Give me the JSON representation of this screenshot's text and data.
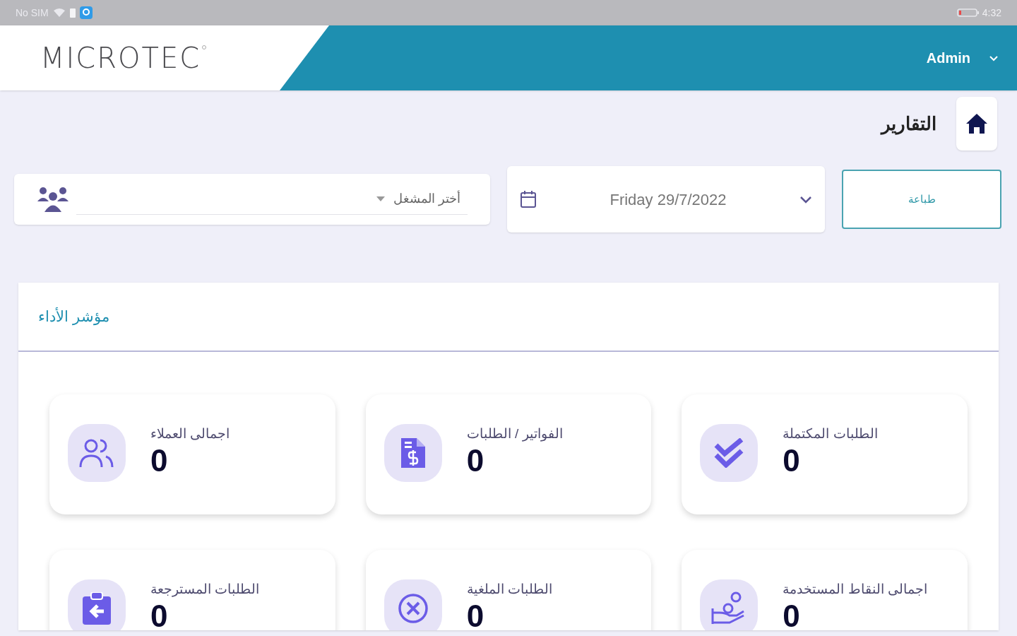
{
  "status_bar": {
    "carrier": "No SIM",
    "time": "4:32"
  },
  "header": {
    "logo": "MICROTEC",
    "user": "Admin"
  },
  "page_title": "التقارير",
  "filters": {
    "print_button": "طباعة",
    "date": "Friday 29/7/2022",
    "operator_select": {
      "placeholder": "أختر المشغل"
    }
  },
  "panel": {
    "title": "مؤشر الأداء",
    "cards": [
      {
        "kind": "check",
        "label": "الطلبات المكتملة",
        "value": "0"
      },
      {
        "kind": "invoice",
        "label": "الفواتير / الطلبات",
        "value": "0"
      },
      {
        "kind": "users",
        "label": "اجمالى العملاء",
        "value": "0"
      },
      {
        "kind": "points",
        "label": "اجمالى النقاط المستخدمة",
        "value": "0"
      },
      {
        "kind": "cancel",
        "label": "الطلبات الملغية",
        "value": "0"
      },
      {
        "kind": "return",
        "label": "الطلبات المسترجعة",
        "value": "0"
      }
    ]
  }
}
